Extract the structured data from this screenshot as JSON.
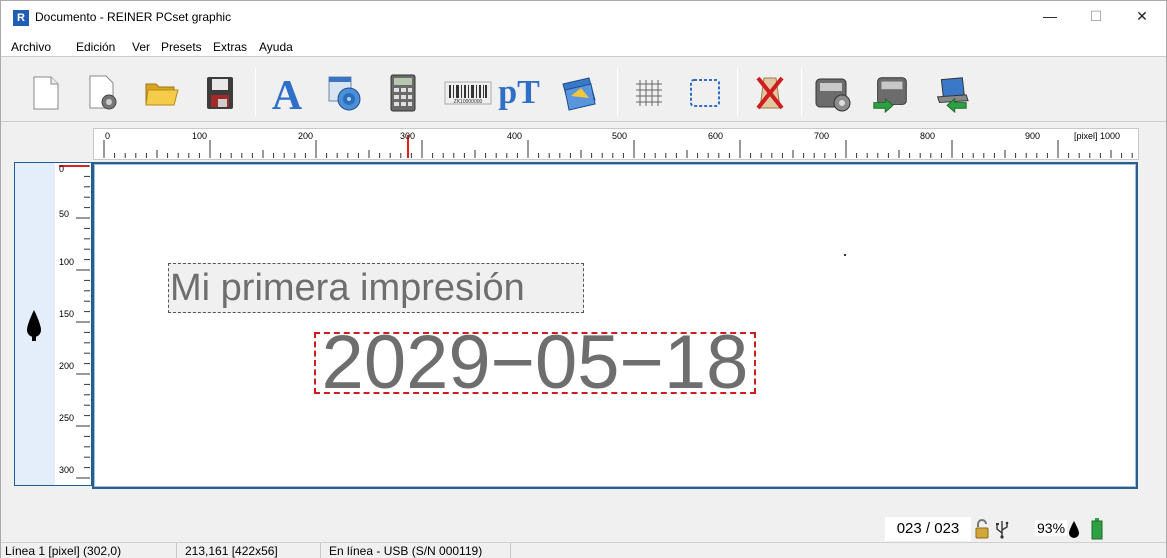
{
  "window": {
    "title": "Documento - REINER PCset graphic",
    "app_icon_letter": "R",
    "minimize": "—",
    "maximize": "☐",
    "close": "✕"
  },
  "menu": [
    "Archivo",
    "Edición",
    "Ver",
    "Presets",
    "Extras",
    "Ayuda"
  ],
  "toolbar": {
    "buttons": [
      "new-document-icon",
      "new-from-template-icon",
      "open-folder-icon",
      "save-floppy-icon",
      "text-a-icon",
      "datetime-counter-icon",
      "calculator-icon",
      "barcode-icon",
      "pt-text-icon",
      "image-import-icon",
      "grid-icon",
      "frame-select-icon",
      "delete-cross-icon",
      "printer-settings-icon",
      "printer-transfer-icon",
      "laptop-receive-icon"
    ],
    "pt_label": "pT",
    "barcode_text": "ZK10000000"
  },
  "ruler_h": {
    "labels": [
      "0",
      "100",
      "200",
      "300",
      "400",
      "500",
      "600",
      "700",
      "800",
      "900"
    ],
    "unit_label": "[pixel] 1000"
  },
  "ruler_v": {
    "labels": [
      "0",
      "50",
      "100",
      "150",
      "200",
      "250",
      "300"
    ]
  },
  "canvas": {
    "field_text": "Mi primera impresión",
    "field_date": "2029−05−18"
  },
  "status_right": {
    "counter": "023 / 023",
    "ink_level": "93%"
  },
  "statusbar": {
    "line": "Línea 1 [pixel] (302,0)",
    "position": "213,161 [422x56]",
    "connection": "En línea - USB (S/N 000119)"
  },
  "colors": {
    "accent_blue": "#1e5fb4",
    "selection_red": "#cc1e1e",
    "battery_green": "#2ea043"
  }
}
